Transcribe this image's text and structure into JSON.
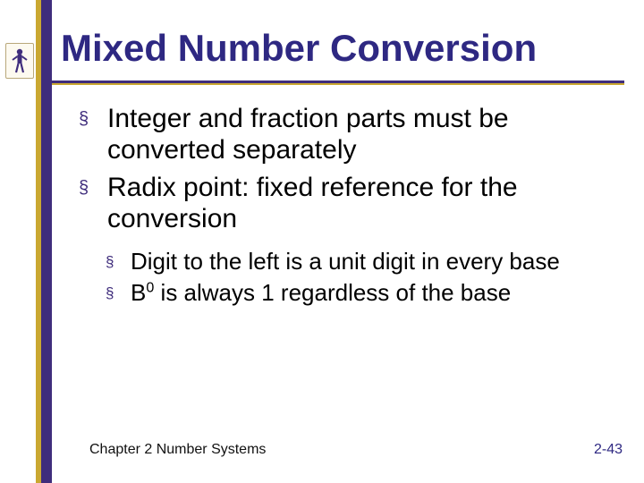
{
  "slide": {
    "title": "Mixed Number Conversion",
    "bullets": [
      {
        "text": "Integer and fraction parts must be converted separately"
      },
      {
        "text": "Radix point: fixed reference for the conversion"
      }
    ],
    "subbullets": [
      {
        "text": "Digit to the left is a unit digit in every base"
      },
      {
        "prefix": "B",
        "exp": "0",
        "suffix": " is always 1 regardless of the base"
      }
    ],
    "footer_left": "Chapter 2 Number Systems",
    "footer_right": "2-43",
    "bullet_glyph": "§"
  }
}
